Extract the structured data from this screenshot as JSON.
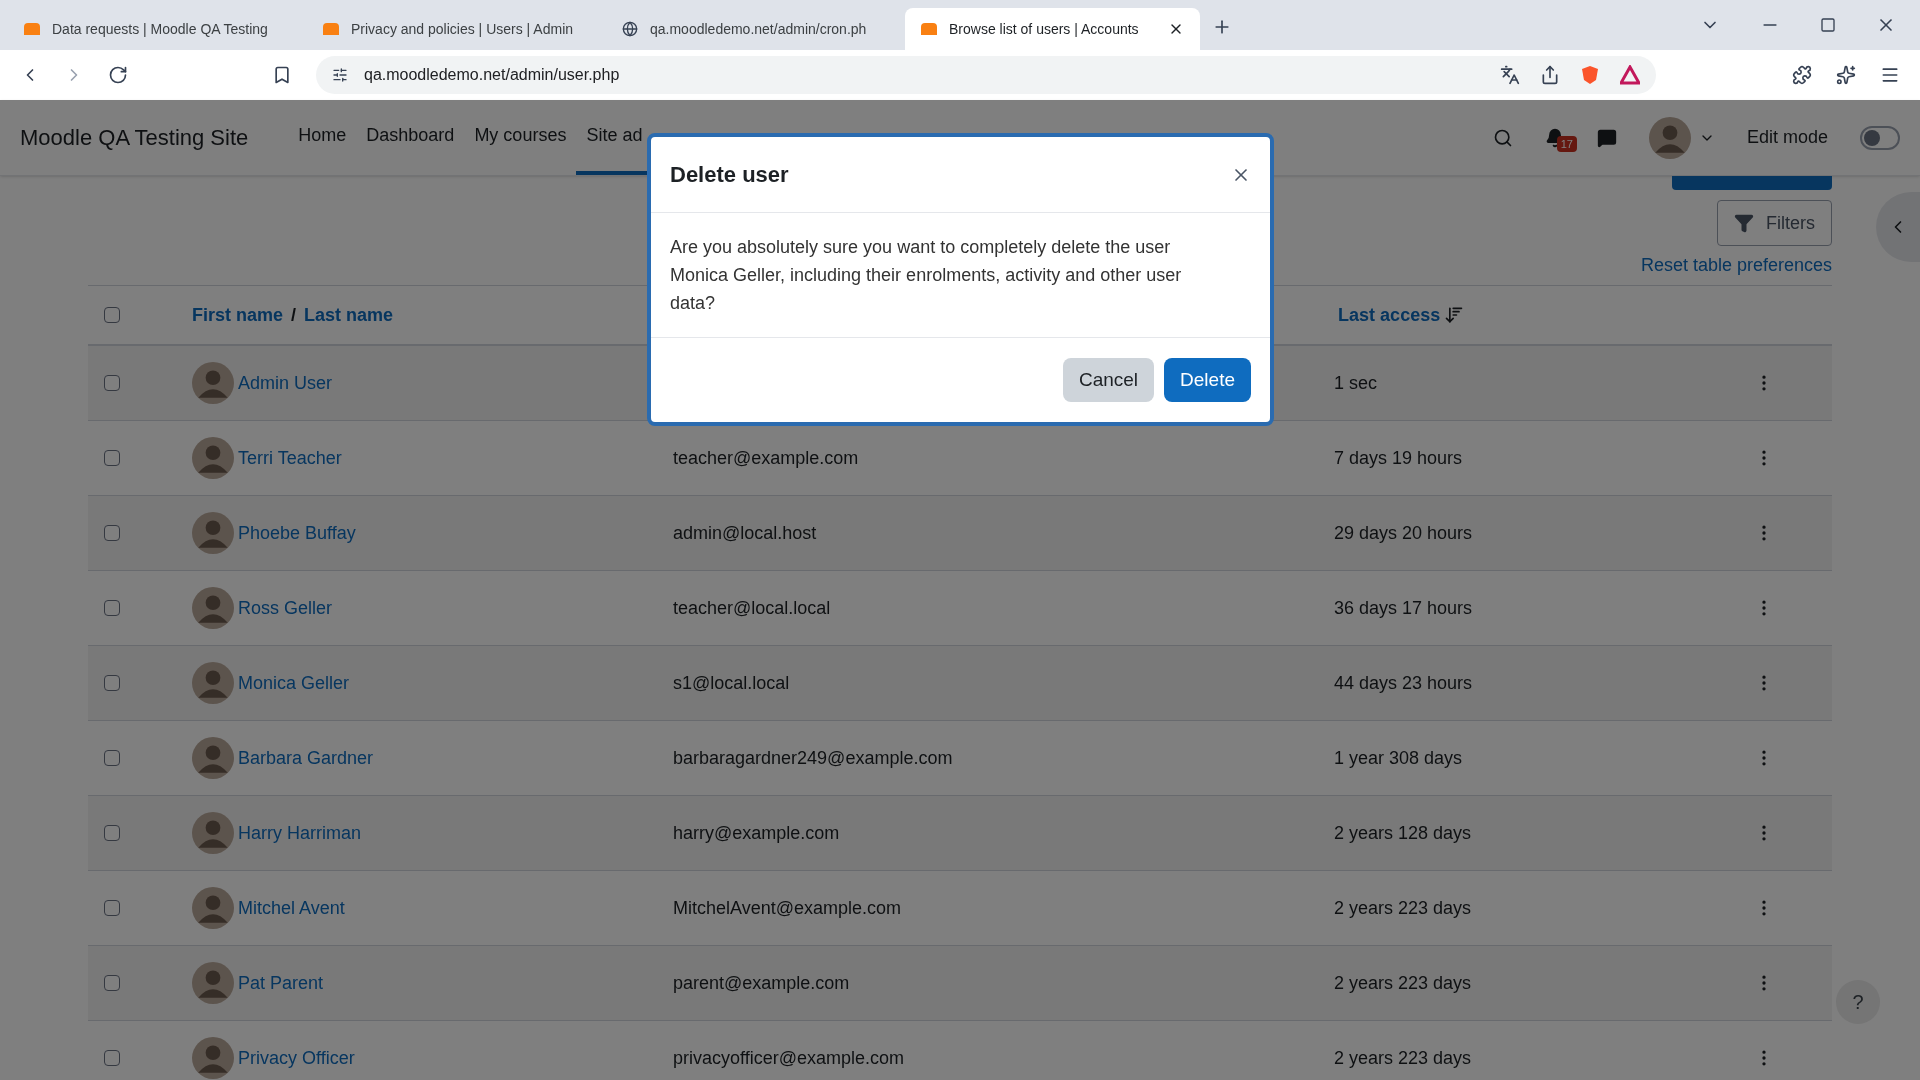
{
  "browser": {
    "tabs": [
      {
        "title": "Data requests | Moodle QA Testing",
        "selected": false
      },
      {
        "title": "Privacy and policies | Users | Admin",
        "selected": false
      },
      {
        "title": "qa.moodledemo.net/admin/cron.ph",
        "selected": false
      },
      {
        "title": "Browse list of users | Accounts",
        "selected": true
      }
    ],
    "url": "qa.moodledemo.net/admin/user.php"
  },
  "site": {
    "name": "Moodle QA Testing Site",
    "nav": [
      {
        "label": "Home",
        "selected": false
      },
      {
        "label": "Dashboard",
        "selected": false
      },
      {
        "label": "My courses",
        "selected": false
      },
      {
        "label": "Site ad",
        "selected": true
      }
    ],
    "notification_count": "17",
    "edit_mode": {
      "label": "Edit mode",
      "on": false
    }
  },
  "toolbar": {
    "filters": "Filters",
    "reset": "Reset table preferences"
  },
  "table": {
    "select_all_checked": false,
    "columns": {
      "first_name": "First name",
      "separator": "/",
      "last_name": "Last name",
      "last_access": "Last access"
    },
    "rows": [
      {
        "name": "Admin User",
        "email": "",
        "last_access": "1 sec",
        "checked": false
      },
      {
        "name": "Terri Teacher",
        "email": "teacher@example.com",
        "last_access": "7 days 19 hours",
        "checked": false
      },
      {
        "name": "Phoebe Buffay",
        "email": "admin@local.host",
        "last_access": "29 days 20 hours",
        "checked": false
      },
      {
        "name": "Ross Geller",
        "email": "teacher@local.local",
        "last_access": "36 days 17 hours",
        "checked": false
      },
      {
        "name": "Monica Geller",
        "email": "s1@local.local",
        "last_access": "44 days 23 hours",
        "checked": false
      },
      {
        "name": "Barbara Gardner",
        "email": "barbaragardner249@example.com",
        "last_access": "1 year 308 days",
        "checked": false
      },
      {
        "name": "Harry Harriman",
        "email": "harry@example.com",
        "last_access": "2 years 128 days",
        "checked": false
      },
      {
        "name": "Mitchel Avent",
        "email": "MitchelAvent@example.com",
        "last_access": "2 years 223 days",
        "checked": false
      },
      {
        "name": "Pat Parent",
        "email": "parent@example.com",
        "last_access": "2 years 223 days",
        "checked": false
      },
      {
        "name": "Privacy Officer",
        "email": "privacyofficer@example.com",
        "last_access": "2 years 223 days",
        "checked": false
      }
    ]
  },
  "help": "?",
  "dialog": {
    "title": "Delete user",
    "message": "Are you absolutely sure you want to completely delete the user Monica Geller, including their enrolments, activity and other user data?",
    "buttons": [
      {
        "label": "Cancel",
        "kind": "secondary"
      },
      {
        "label": "Delete",
        "kind": "primary"
      }
    ]
  }
}
